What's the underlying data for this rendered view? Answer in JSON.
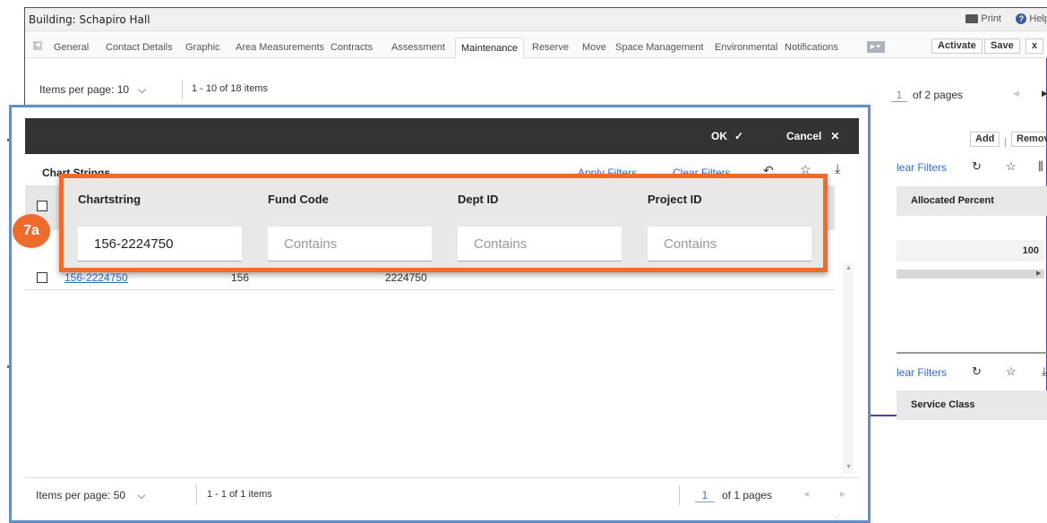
{
  "window": {
    "title": "Building: Schapiro Hall",
    "print_label": "Print",
    "help_label": "Help"
  },
  "tabs": [
    {
      "label": "General"
    },
    {
      "label": "Contact Details"
    },
    {
      "label": "Graphic"
    },
    {
      "label": "Area Measurements"
    },
    {
      "label": "Contracts"
    },
    {
      "label": "Assessment"
    },
    {
      "label": "Maintenance",
      "active": true
    },
    {
      "label": "Reserve"
    },
    {
      "label": "Move"
    },
    {
      "label": "Space Management"
    },
    {
      "label": "Environmental"
    },
    {
      "label": "Notifications"
    }
  ],
  "toolbar": {
    "activate_label": "Activate",
    "save_label": "Save",
    "close_label": "x"
  },
  "bg_pager": {
    "items_per_page": "Items per page:  10",
    "range": "1 - 10 of 18 items"
  },
  "right_panel": {
    "page_current": "1",
    "page_total": "of 2 pages",
    "add_label": "Add",
    "separator": "|",
    "remove_label": "Remove",
    "clear_filters_1": "lear Filters",
    "col_header_1": "Allocated Percent",
    "row_value": "100",
    "clear_filters_2": "lear Filters",
    "col_header_2": "Service Class"
  },
  "dialog": {
    "ok_label": "OK",
    "cancel_label": "Cancel",
    "title": "Chart Strings",
    "apply_filters": "Apply Filters",
    "clear_filters": "Clear Filters",
    "columns": [
      {
        "label": "Chartstring",
        "value": "156-2224750",
        "placeholder": "Contains"
      },
      {
        "label": "Fund Code",
        "value": "",
        "placeholder": "Contains"
      },
      {
        "label": "Dept ID",
        "value": "",
        "placeholder": "Contains"
      },
      {
        "label": "Project ID",
        "value": "",
        "placeholder": "Contains"
      }
    ],
    "rows": [
      {
        "chartstring": "156-2224750",
        "fund_code": "156",
        "dept_id": "2224750",
        "project_id": ""
      }
    ],
    "footer": {
      "items_per_page": "Items per page:  50",
      "range": "1 - 1 of 1 items",
      "page_current": "1",
      "page_total": "of 1 pages"
    }
  },
  "callout": {
    "step": "7a",
    "color": "#ef6b2b"
  },
  "colors": {
    "accent_link": "#2d6fcd",
    "dialog_bar": "#333333",
    "window_border": "#5b3f8f",
    "dialog_frame": "#6191c7"
  }
}
